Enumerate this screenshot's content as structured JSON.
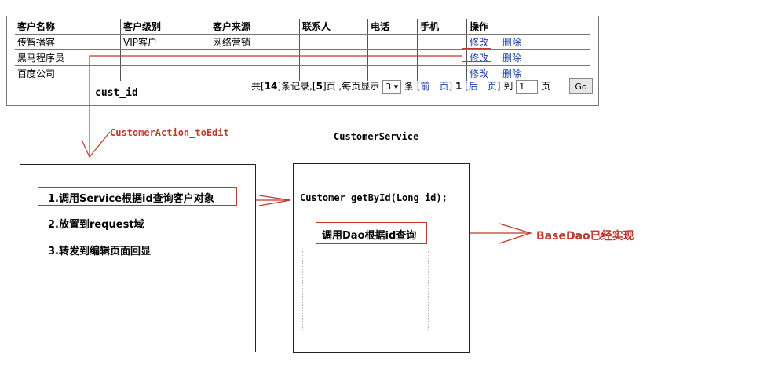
{
  "table": {
    "headers": [
      "客户名称",
      "客户级别",
      "客户来源",
      "联系人",
      "电话",
      "手机",
      "操作"
    ],
    "rows": [
      [
        "传智播客",
        "VIP客户",
        "网络营销",
        "",
        "",
        ""
      ],
      [
        "黑马程序员",
        "",
        "",
        "",
        "",
        ""
      ],
      [
        "百度公司",
        "",
        "",
        "",
        "",
        ""
      ]
    ],
    "edit_label": "修改",
    "delete_label": "删除"
  },
  "pager": {
    "total_prefix": "共[",
    "total_records": "14",
    "total_mid": "]条记录,[",
    "total_pages": "5",
    "total_suffix": "]页 ,每页显示",
    "page_size": "3",
    "page_size_arrow": "▾",
    "unit": "条",
    "prev": "[前一页]",
    "current": "1",
    "next": "[后一页]",
    "goto_label": "到",
    "goto_value": "1",
    "page_unit": "页",
    "go": "Go"
  },
  "diagram": {
    "param_label": "cust_id",
    "action_label": "CustomerAction_toEdit",
    "service_title": "CustomerService",
    "action_steps": [
      "1.调用Service根据id查询客户对象",
      "2.放置到request域",
      "3.转发到编辑页面回显"
    ],
    "service_method": "Customer getById(Long id);",
    "service_step": "调用Dao根据id查询",
    "basedao_note": "BaseDao已经实现"
  },
  "colors": {
    "annotation": "#c0392b",
    "link": "#1a3ea8"
  }
}
